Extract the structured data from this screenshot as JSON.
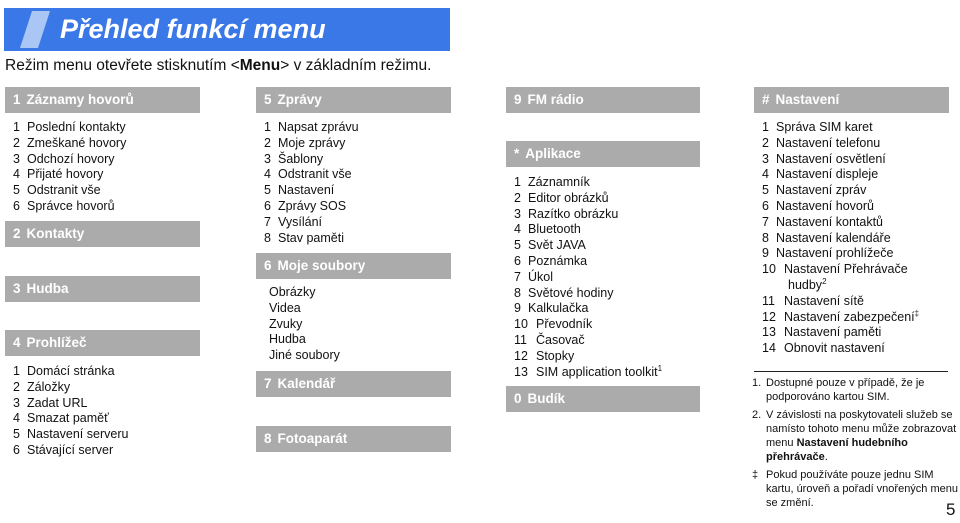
{
  "title": "Přehled funkcí menu",
  "intro": {
    "before": "Režim menu otevřete stisknutím <",
    "key": "Menu",
    "after": "> v základním režimu."
  },
  "colors": {
    "title_bar": "#3b78e7",
    "title_slash": "#a9c6f5",
    "section_header": "#ababab"
  },
  "menus": {
    "m1": {
      "num": "1",
      "label": "Záznamy hovorů",
      "items": [
        {
          "n": "1",
          "label": "Poslední kontakty"
        },
        {
          "n": "2",
          "label": "Zmeškané hovory"
        },
        {
          "n": "3",
          "label": "Odchozí hovory"
        },
        {
          "n": "4",
          "label": "Přijaté hovory"
        },
        {
          "n": "5",
          "label": "Odstranit vše"
        },
        {
          "n": "6",
          "label": "Správce hovorů"
        }
      ]
    },
    "m2": {
      "num": "2",
      "label": "Kontakty"
    },
    "m3": {
      "num": "3",
      "label": "Hudba"
    },
    "m4": {
      "num": "4",
      "label": "Prohlížeč",
      "items": [
        {
          "n": "1",
          "label": "Domácí stránka"
        },
        {
          "n": "2",
          "label": "Záložky"
        },
        {
          "n": "3",
          "label": "Zadat URL"
        },
        {
          "n": "4",
          "label": "Smazat paměť"
        },
        {
          "n": "5",
          "label": "Nastavení serveru"
        },
        {
          "n": "6",
          "label": "Stávající server"
        }
      ]
    },
    "m5": {
      "num": "5",
      "label": "Zprávy",
      "items": [
        {
          "n": "1",
          "label": "Napsat zprávu"
        },
        {
          "n": "2",
          "label": "Moje zprávy"
        },
        {
          "n": "3",
          "label": "Šablony"
        },
        {
          "n": "4",
          "label": "Odstranit vše"
        },
        {
          "n": "5",
          "label": "Nastavení"
        },
        {
          "n": "6",
          "label": "Zprávy SOS"
        },
        {
          "n": "7",
          "label": "Vysílání"
        },
        {
          "n": "8",
          "label": "Stav paměti"
        }
      ]
    },
    "m6": {
      "num": "6",
      "label": "Moje soubory",
      "items": [
        "Obrázky",
        "Videa",
        "Zvuky",
        "Hudba",
        "Jiné soubory"
      ]
    },
    "m7": {
      "num": "7",
      "label": "Kalendář"
    },
    "m8": {
      "num": "8",
      "label": "Fotoaparát"
    },
    "m9": {
      "num": "9",
      "label": "FM rádio"
    },
    "mstar": {
      "num": "*",
      "label": "Aplikace",
      "items": [
        {
          "n": "1",
          "label": "Záznamník"
        },
        {
          "n": "2",
          "label": "Editor obrázků"
        },
        {
          "n": "3",
          "label": "Razítko obrázku"
        },
        {
          "n": "4",
          "label": "Bluetooth"
        },
        {
          "n": "5",
          "label": "Svět JAVA"
        },
        {
          "n": "6",
          "label": "Poznámka"
        },
        {
          "n": "7",
          "label": "Úkol"
        },
        {
          "n": "8",
          "label": "Světové hodiny"
        },
        {
          "n": "9",
          "label": "Kalkulačka"
        },
        {
          "n": "10",
          "label": "Převodník"
        },
        {
          "n": "11",
          "label": "Časovač"
        },
        {
          "n": "12",
          "label": "Stopky"
        },
        {
          "n": "13",
          "label": "SIM application toolkit",
          "sup": "1"
        }
      ]
    },
    "m0": {
      "num": "0",
      "label": "Budík"
    },
    "mhash": {
      "num": "#",
      "label": "Nastavení",
      "items": [
        {
          "n": "1",
          "label": "Správa SIM karet"
        },
        {
          "n": "2",
          "label": "Nastavení telefonu"
        },
        {
          "n": "3",
          "label": "Nastavení osvětlení"
        },
        {
          "n": "4",
          "label": "Nastavení displeje"
        },
        {
          "n": "5",
          "label": "Nastavení zpráv"
        },
        {
          "n": "6",
          "label": "Nastavení hovorů"
        },
        {
          "n": "7",
          "label": "Nastavení kontaktů"
        },
        {
          "n": "8",
          "label": "Nastavení kalendáře"
        },
        {
          "n": "9",
          "label": "Nastavení prohlížeče"
        },
        {
          "n": "10",
          "label": "Nastavení Přehrávače",
          "cont": "hudby",
          "sup": "2"
        },
        {
          "n": "11",
          "label": "Nastavení sítě"
        },
        {
          "n": "12",
          "label": "Nastavení zabezpečení",
          "sup": "‡"
        },
        {
          "n": "13",
          "label": "Nastavení paměti"
        },
        {
          "n": "14",
          "label": "Obnovit nastavení"
        }
      ]
    }
  },
  "footnotes": [
    {
      "mark": "1.",
      "text": "Dostupné pouze v případě, že je podporováno kartou SIM."
    },
    {
      "mark": "2.",
      "text": "V závislosti na poskytovateli služeb se namísto tohoto menu může zobrazovat menu ",
      "bold": "Nastavení hudebního přehrávače",
      "after": "."
    },
    {
      "mark": "‡",
      "text": "Pokud používáte pouze jednu SIM kartu, úroveň a pořadí vnořených menu se změní."
    }
  ],
  "page_number": "5"
}
